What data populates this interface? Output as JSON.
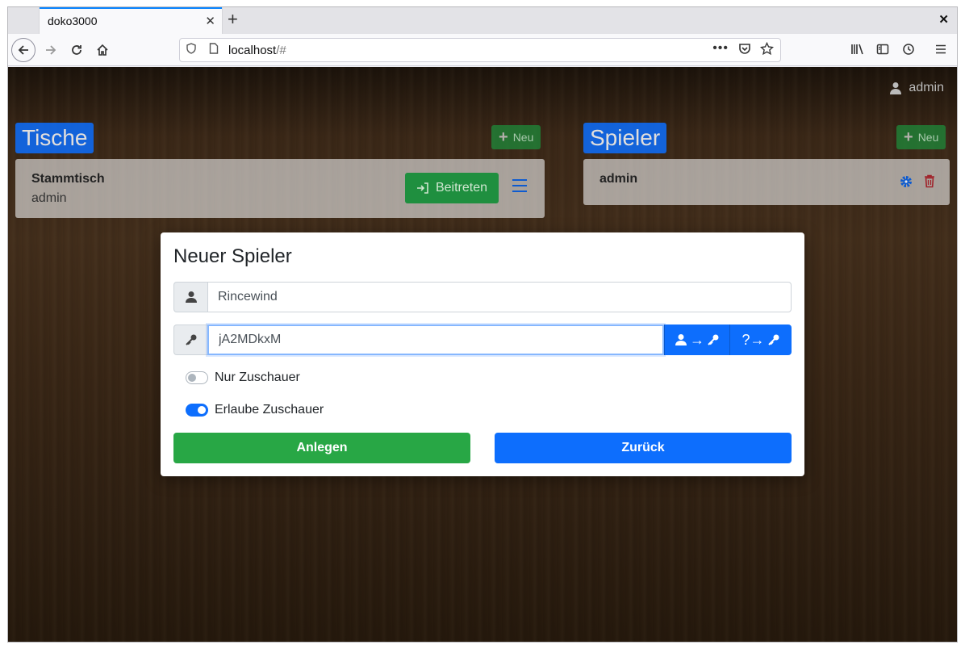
{
  "browser": {
    "tab_title": "doko3000",
    "tab_close": "✕",
    "new_tab": "+",
    "window_close": "✕",
    "url_host": "localhost",
    "url_rest": "/#",
    "url_more": "•••"
  },
  "header": {
    "user": "admin"
  },
  "tables_panel": {
    "title": "Tische",
    "new_label": "Neu",
    "cards": [
      {
        "name": "Stammtisch",
        "owner": "admin",
        "join_label": "Beitreten"
      }
    ]
  },
  "players_panel": {
    "title": "Spieler",
    "new_label": "Neu",
    "players": [
      {
        "name": "admin"
      }
    ]
  },
  "modal": {
    "title": "Neuer Spieler",
    "username_value": "Rincewind",
    "password_value": "jA2MDkxM",
    "btn_user_to_key_arrow": "→",
    "btn_random_key_text": "?→",
    "switch_spectator_only": "Nur Zuschauer",
    "switch_allow_spectators": "Erlaube Zuschauer",
    "spectator_only_on": false,
    "allow_spectators_on": true,
    "create_label": "Anlegen",
    "back_label": "Zurück"
  },
  "colors": {
    "primary": "#0d6efd",
    "success": "#28a745",
    "danger": "#a0222a"
  },
  "icons": [
    "shield-icon",
    "page-icon",
    "pocket-icon",
    "star-icon",
    "library-icon",
    "sidebar-icon",
    "history-icon",
    "hamburger-icon",
    "user-icon",
    "plus-icon",
    "enter-icon",
    "menu-icon",
    "gear-icon",
    "trash-icon",
    "key-icon"
  ]
}
